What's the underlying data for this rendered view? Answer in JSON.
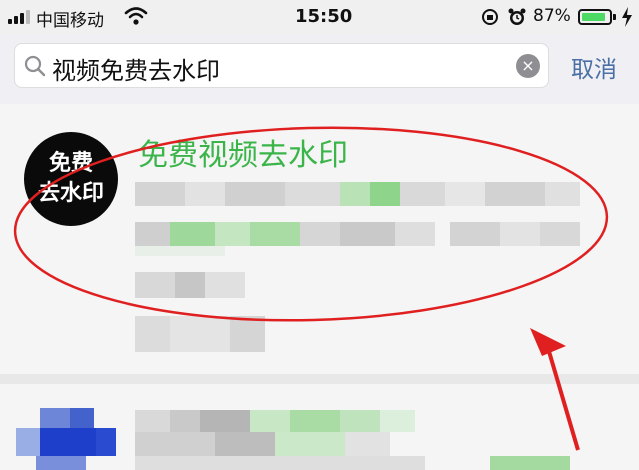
{
  "status_bar": {
    "carrier": "中国移动",
    "time": "15:50",
    "battery_percent": "87%",
    "battery_level": 0.87,
    "icons": [
      "signal-icon",
      "wifi-icon",
      "rotation-lock-icon",
      "alarm-icon",
      "battery-icon",
      "charging-icon"
    ]
  },
  "search": {
    "query": "视频免费去水印",
    "cancel_label": "取消",
    "clear_icon": "×"
  },
  "results": [
    {
      "avatar_text": [
        "免费",
        "去水印"
      ],
      "title": "免费视频去水印"
    }
  ],
  "colors": {
    "title_green": "#3bb54a",
    "cancel_blue": "#4a6fa5",
    "annotation_red": "#e02020",
    "battery_green": "#4cd964"
  }
}
